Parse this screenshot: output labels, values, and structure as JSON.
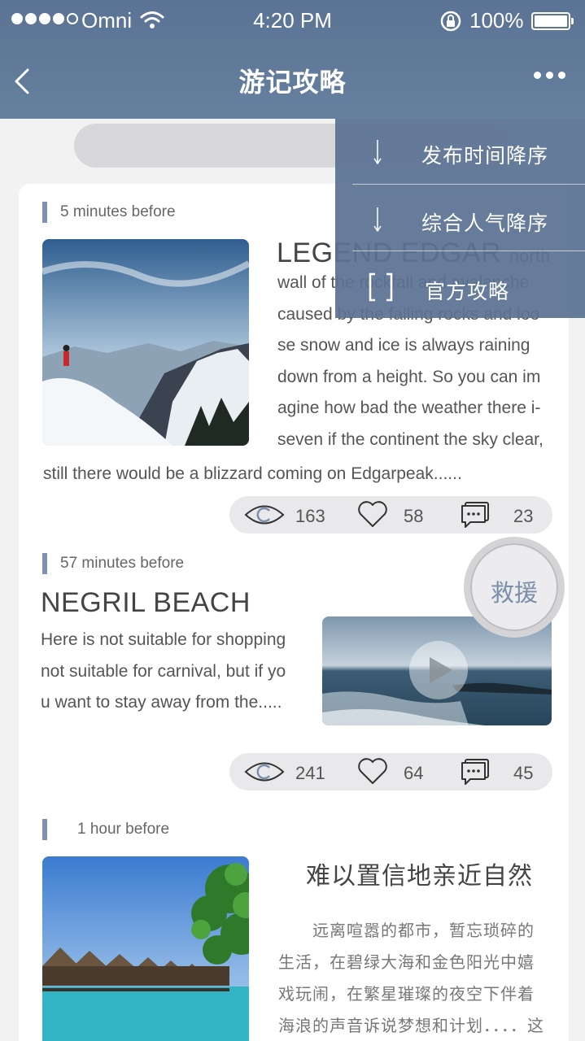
{
  "status_bar": {
    "carrier": "Omni",
    "time": "4:20 PM",
    "battery": "100%"
  },
  "header": {
    "title": "游记攻略"
  },
  "menu": {
    "items": [
      {
        "label": "发布时间降序",
        "icon": "arrow-down-icon"
      },
      {
        "label": "综合人气降序",
        "icon": "arrow-down-icon"
      },
      {
        "label": "官方攻略",
        "icon": "bracket-icon"
      }
    ]
  },
  "rescue": {
    "label": "救援"
  },
  "posts": [
    {
      "time": "5 minutes before",
      "title": "LEGEND EDGAR",
      "title_suffix": "north",
      "lines": [
        "wall  of the rockfall and avalanche",
        "caused by the falling rocks and loo",
        "se snow and ice is  always  raining",
        "down from a height. So you can im",
        "agine how bad the weather there i-",
        "seven if the continent the sky clear,"
      ],
      "last_line": "still there would be a blizzard coming on Edgarpeak......",
      "views": "163",
      "likes": "58",
      "comments": "23"
    },
    {
      "time": "57 minutes before",
      "title": "NEGRIL BEACH",
      "lines": [
        "Here is not suitable for shopping",
        "not suitable for carnival, but if yo",
        "u want to stay away from the....."
      ],
      "views": "241",
      "likes": "64",
      "comments": "45"
    },
    {
      "time": "1 hour before",
      "title": "难以置信地亲近自然",
      "lines": [
        "　　远离喧嚣的都市，暂忘琐碎的",
        "生活，在碧绿大海和金色阳光中嬉",
        "戏玩闹，在繁星璀璨的夜空下伴着",
        "海浪的声音诉说梦想和计划．．．．这"
      ]
    }
  ]
}
